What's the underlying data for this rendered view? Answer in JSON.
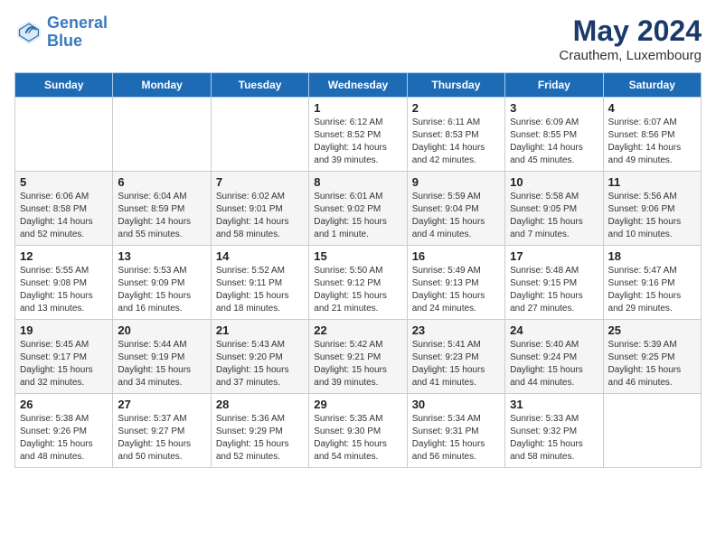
{
  "logo": {
    "line1": "General",
    "line2": "Blue"
  },
  "title": "May 2024",
  "subtitle": "Crauthem, Luxembourg",
  "weekdays": [
    "Sunday",
    "Monday",
    "Tuesday",
    "Wednesday",
    "Thursday",
    "Friday",
    "Saturday"
  ],
  "weeks": [
    [
      {
        "day": "",
        "sunrise": "",
        "sunset": "",
        "daylight": ""
      },
      {
        "day": "",
        "sunrise": "",
        "sunset": "",
        "daylight": ""
      },
      {
        "day": "",
        "sunrise": "",
        "sunset": "",
        "daylight": ""
      },
      {
        "day": "1",
        "sunrise": "6:12 AM",
        "sunset": "8:52 PM",
        "daylight": "14 hours and 39 minutes."
      },
      {
        "day": "2",
        "sunrise": "6:11 AM",
        "sunset": "8:53 PM",
        "daylight": "14 hours and 42 minutes."
      },
      {
        "day": "3",
        "sunrise": "6:09 AM",
        "sunset": "8:55 PM",
        "daylight": "14 hours and 45 minutes."
      },
      {
        "day": "4",
        "sunrise": "6:07 AM",
        "sunset": "8:56 PM",
        "daylight": "14 hours and 49 minutes."
      }
    ],
    [
      {
        "day": "5",
        "sunrise": "6:06 AM",
        "sunset": "8:58 PM",
        "daylight": "14 hours and 52 minutes."
      },
      {
        "day": "6",
        "sunrise": "6:04 AM",
        "sunset": "8:59 PM",
        "daylight": "14 hours and 55 minutes."
      },
      {
        "day": "7",
        "sunrise": "6:02 AM",
        "sunset": "9:01 PM",
        "daylight": "14 hours and 58 minutes."
      },
      {
        "day": "8",
        "sunrise": "6:01 AM",
        "sunset": "9:02 PM",
        "daylight": "15 hours and 1 minute."
      },
      {
        "day": "9",
        "sunrise": "5:59 AM",
        "sunset": "9:04 PM",
        "daylight": "15 hours and 4 minutes."
      },
      {
        "day": "10",
        "sunrise": "5:58 AM",
        "sunset": "9:05 PM",
        "daylight": "15 hours and 7 minutes."
      },
      {
        "day": "11",
        "sunrise": "5:56 AM",
        "sunset": "9:06 PM",
        "daylight": "15 hours and 10 minutes."
      }
    ],
    [
      {
        "day": "12",
        "sunrise": "5:55 AM",
        "sunset": "9:08 PM",
        "daylight": "15 hours and 13 minutes."
      },
      {
        "day": "13",
        "sunrise": "5:53 AM",
        "sunset": "9:09 PM",
        "daylight": "15 hours and 16 minutes."
      },
      {
        "day": "14",
        "sunrise": "5:52 AM",
        "sunset": "9:11 PM",
        "daylight": "15 hours and 18 minutes."
      },
      {
        "day": "15",
        "sunrise": "5:50 AM",
        "sunset": "9:12 PM",
        "daylight": "15 hours and 21 minutes."
      },
      {
        "day": "16",
        "sunrise": "5:49 AM",
        "sunset": "9:13 PM",
        "daylight": "15 hours and 24 minutes."
      },
      {
        "day": "17",
        "sunrise": "5:48 AM",
        "sunset": "9:15 PM",
        "daylight": "15 hours and 27 minutes."
      },
      {
        "day": "18",
        "sunrise": "5:47 AM",
        "sunset": "9:16 PM",
        "daylight": "15 hours and 29 minutes."
      }
    ],
    [
      {
        "day": "19",
        "sunrise": "5:45 AM",
        "sunset": "9:17 PM",
        "daylight": "15 hours and 32 minutes."
      },
      {
        "day": "20",
        "sunrise": "5:44 AM",
        "sunset": "9:19 PM",
        "daylight": "15 hours and 34 minutes."
      },
      {
        "day": "21",
        "sunrise": "5:43 AM",
        "sunset": "9:20 PM",
        "daylight": "15 hours and 37 minutes."
      },
      {
        "day": "22",
        "sunrise": "5:42 AM",
        "sunset": "9:21 PM",
        "daylight": "15 hours and 39 minutes."
      },
      {
        "day": "23",
        "sunrise": "5:41 AM",
        "sunset": "9:23 PM",
        "daylight": "15 hours and 41 minutes."
      },
      {
        "day": "24",
        "sunrise": "5:40 AM",
        "sunset": "9:24 PM",
        "daylight": "15 hours and 44 minutes."
      },
      {
        "day": "25",
        "sunrise": "5:39 AM",
        "sunset": "9:25 PM",
        "daylight": "15 hours and 46 minutes."
      }
    ],
    [
      {
        "day": "26",
        "sunrise": "5:38 AM",
        "sunset": "9:26 PM",
        "daylight": "15 hours and 48 minutes."
      },
      {
        "day": "27",
        "sunrise": "5:37 AM",
        "sunset": "9:27 PM",
        "daylight": "15 hours and 50 minutes."
      },
      {
        "day": "28",
        "sunrise": "5:36 AM",
        "sunset": "9:29 PM",
        "daylight": "15 hours and 52 minutes."
      },
      {
        "day": "29",
        "sunrise": "5:35 AM",
        "sunset": "9:30 PM",
        "daylight": "15 hours and 54 minutes."
      },
      {
        "day": "30",
        "sunrise": "5:34 AM",
        "sunset": "9:31 PM",
        "daylight": "15 hours and 56 minutes."
      },
      {
        "day": "31",
        "sunrise": "5:33 AM",
        "sunset": "9:32 PM",
        "daylight": "15 hours and 58 minutes."
      },
      {
        "day": "",
        "sunrise": "",
        "sunset": "",
        "daylight": ""
      }
    ]
  ]
}
